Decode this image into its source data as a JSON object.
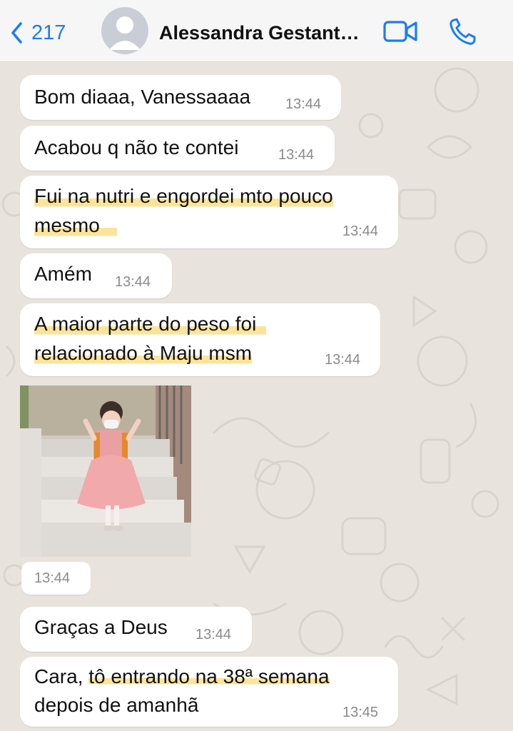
{
  "header": {
    "back_count": "217",
    "contact_name": "Alessandra Gestant…"
  },
  "messages": [
    {
      "text": "Bom diaaa, Vanessaaaa",
      "time": "13:44"
    },
    {
      "text": "Acabou q não te contei",
      "time": "13:44"
    },
    {
      "line1": "Fui na nutri e engordei mto pouco",
      "line2": "mesmo",
      "time": "13:44"
    },
    {
      "text": "Amém",
      "time": "13:44"
    },
    {
      "line1": "A maior parte do peso foi",
      "line2": "relacionado à Maju msm",
      "time": "13:44"
    },
    {
      "image": "girl-in-pink-dress-on-stairs",
      "time": "13:44"
    },
    {
      "text": "Graças a Deus",
      "time": "13:44"
    },
    {
      "line1_a": "Cara, ",
      "line1_b": "tô entrando na 38ª semana",
      "line2": "depois de amanhã",
      "time": "13:45"
    }
  ],
  "icons": {
    "back": "chevron-left-icon",
    "avatar": "person-placeholder-icon",
    "video": "video-camera-icon",
    "call": "phone-icon"
  },
  "colors": {
    "accent": "#1a7cf5",
    "highlight": "#fbe49a",
    "bubble": "#ffffff",
    "wallpaper": "#e8e4dd"
  }
}
